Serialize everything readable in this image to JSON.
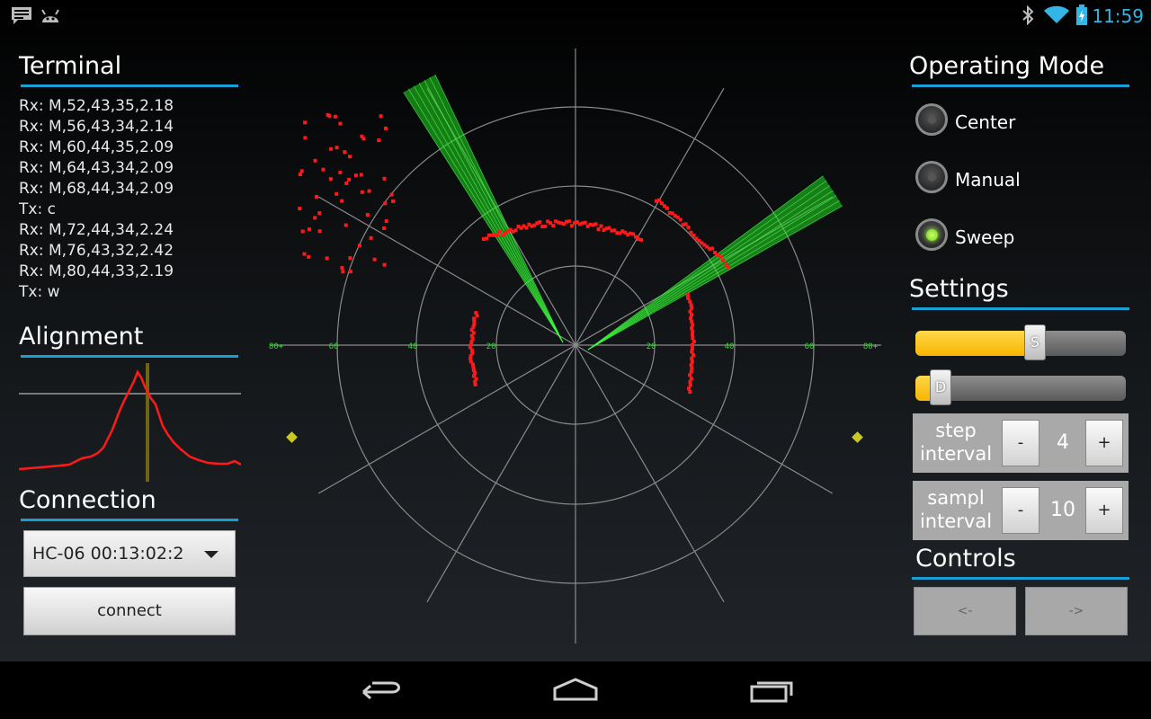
{
  "status_bar": {
    "time": "11:59",
    "left_icons": [
      "chat-icon",
      "android-icon"
    ],
    "right_icons": [
      "bluetooth-icon",
      "wifi-icon",
      "battery-icon"
    ]
  },
  "terminal": {
    "title": "Terminal",
    "lines": [
      "Rx: M,52,43,35,2.18",
      "Rx: M,56,43,34,2.14",
      "Rx: M,60,44,35,2.09",
      "Rx: M,64,43,34,2.09",
      "Rx: M,68,44,34,2.09",
      "Tx: c",
      "Rx: M,72,44,34,2.24",
      "Rx: M,76,43,32,2.42",
      "Rx: M,80,44,33,2.19",
      "Tx: w"
    ]
  },
  "alignment": {
    "title": "Alignment"
  },
  "connection": {
    "title": "Connection",
    "device_value": "HC-06 00:13:02:2",
    "connect_label": "connect"
  },
  "radar": {
    "axis_labels_left": [
      "80+",
      "60",
      "40",
      "20"
    ],
    "axis_labels_right": [
      "20",
      "40",
      "60",
      "80+"
    ],
    "colors": {
      "points": "#ff1a1a",
      "beam": "#22dd22",
      "grid": "#8a8a8a",
      "labels": "#33dd33",
      "marker": "#c8c820"
    }
  },
  "operating_mode": {
    "title": "Operating Mode",
    "options": [
      {
        "label": "Center",
        "selected": false
      },
      {
        "label": "Manual",
        "selected": false
      },
      {
        "label": "Sweep",
        "selected": true
      }
    ]
  },
  "settings": {
    "title": "Settings",
    "slider_s": {
      "label": "S",
      "value_fraction": 0.57
    },
    "slider_d": {
      "label": "D",
      "value_fraction": 0.12
    },
    "step": {
      "label": "step interval",
      "value": "4",
      "minus": "-",
      "plus": "+"
    },
    "sampl": {
      "label": "sampl interval",
      "value": "10",
      "minus": "-",
      "plus": "+"
    }
  },
  "controls": {
    "title": "Controls",
    "left_label": "<-",
    "right_label": "->"
  },
  "navigation": {
    "icons": [
      "back-icon",
      "home-icon",
      "recent-apps-icon"
    ]
  }
}
